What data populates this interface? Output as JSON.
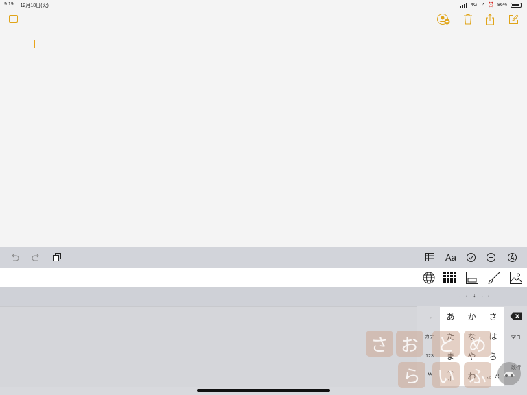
{
  "status_bar": {
    "time": "9:19",
    "date": "12月18日(火)",
    "network": "4G",
    "battery": "86%",
    "battery_level": 0.86
  },
  "keyboard": {
    "arrows": "←← ↓ →→",
    "forward_arrow": "→",
    "keys": [
      "あ",
      "か",
      "さ",
      "た",
      "な",
      "は",
      "ま",
      "や",
      "ら",
      "^^",
      "わ",
      "、。?!"
    ],
    "small_key_label": "小",
    "left_labels": [
      "カナ",
      "123",
      "ᴬᴬ"
    ],
    "right_labels": [
      "空白",
      "改行"
    ]
  },
  "watermark": {
    "chars": [
      "さ",
      "お",
      "と",
      "め",
      "ら",
      "い",
      "ふ"
    ]
  },
  "colors": {
    "accent": "#e0a418",
    "toolbar_bg": "#d2d4da",
    "keyboard_bg": "#d8d9dd"
  }
}
